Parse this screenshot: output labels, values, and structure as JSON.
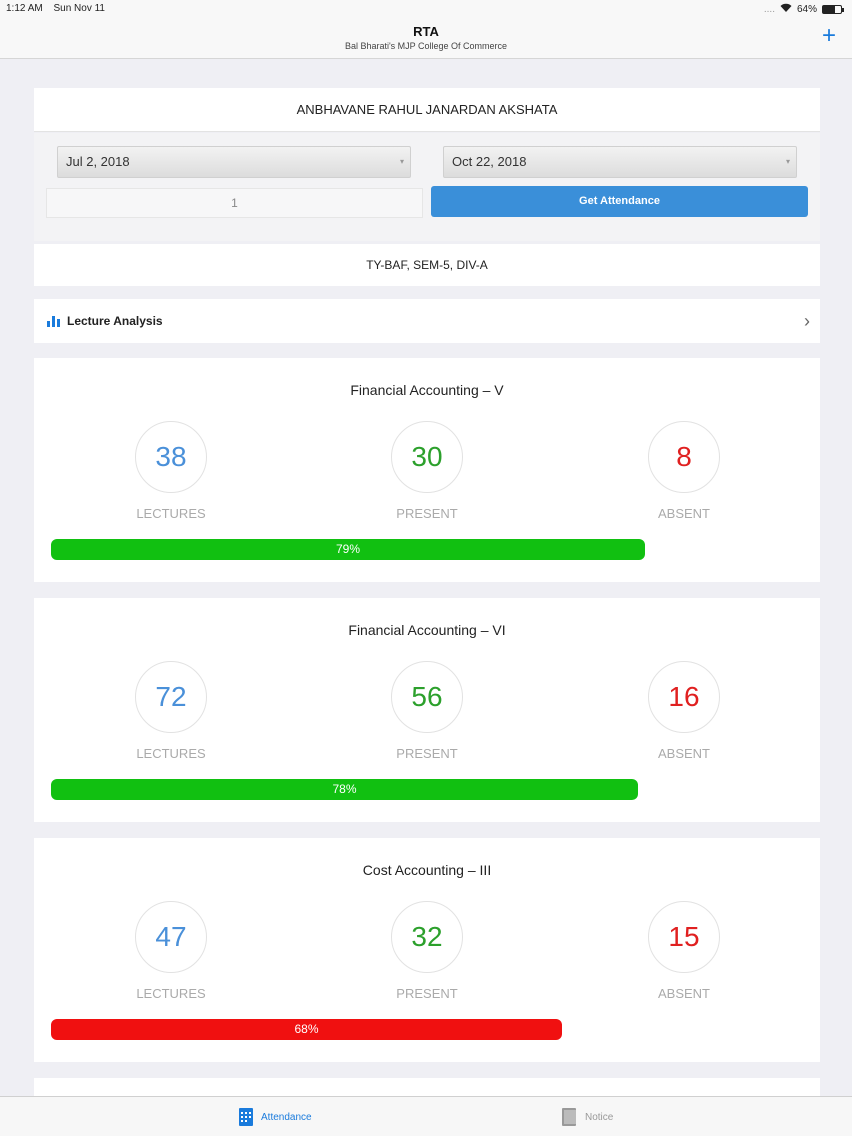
{
  "status": {
    "time": "1:12 AM",
    "date": "Sun Nov 11",
    "signal": "....",
    "battery": "64%"
  },
  "nav": {
    "title": "RTA",
    "subtitle": "Bal Bharati's MJP College Of Commerce",
    "add_icon": "plus-icon"
  },
  "student": {
    "name": "ANBHAVANE RAHUL JANARDAN AKSHATA"
  },
  "filters": {
    "from_date": "Jul 2, 2018",
    "to_date": "Oct 22, 2018",
    "number_value": "1",
    "button_label": "Get Attendance"
  },
  "class_info": "TY-BAF,  SEM-5,  DIV-A",
  "analysis": {
    "label": "Lecture Analysis",
    "icon": "bar-chart-icon"
  },
  "labels": {
    "lectures": "LECTURES",
    "present": "PRESENT",
    "absent": "ABSENT"
  },
  "subjects": [
    {
      "name": "Financial Accounting – V",
      "lectures": "38",
      "present": "30",
      "absent": "8",
      "percent_label": "79%",
      "percent": 79,
      "bar_color": "#11c011"
    },
    {
      "name": "Financial Accounting – VI",
      "lectures": "72",
      "present": "56",
      "absent": "16",
      "percent_label": "78%",
      "percent": 78,
      "bar_color": "#11c011"
    },
    {
      "name": "Cost Accounting – III",
      "lectures": "47",
      "present": "32",
      "absent": "15",
      "percent_label": "68%",
      "percent": 68,
      "bar_color": "#f01010"
    }
  ],
  "tabs": {
    "attendance": "Attendance",
    "notice": "Notice"
  },
  "colors": {
    "accent": "#1a7bdc",
    "button": "#3a8fd9",
    "good": "#11c011",
    "bad": "#f01010"
  }
}
